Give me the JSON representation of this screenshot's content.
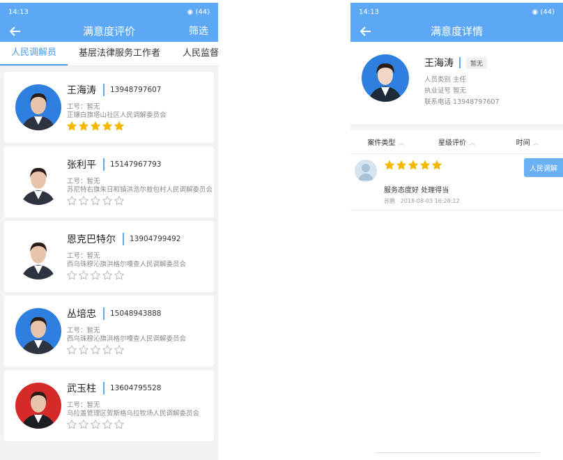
{
  "left": {
    "status": {
      "time": "14:13",
      "signal": "3G 3G",
      "battery": "44"
    },
    "appbar": {
      "title": "满意度评价",
      "action": "筛选"
    },
    "tabs": [
      "人民调解员",
      "基层法律服务工作者",
      "人民监督员"
    ],
    "people": [
      {
        "name": "王海涛",
        "phone": "13948797607",
        "job_no": "工号：暂无",
        "org": "正镶白旗塔山社区人民调解委员会",
        "rating": 5,
        "bg": "#2f7fe0"
      },
      {
        "name": "张利平",
        "phone": "15147967793",
        "job_no": "工号：暂无",
        "org": "苏尼特右旗朱日和镇洪浩尔敖包村人民调解委员会",
        "rating": 0,
        "bg": "#ffffff"
      },
      {
        "name": "恩克巴特尔",
        "phone": "13904799492",
        "job_no": "工号：暂无",
        "org": "西乌珠穆沁旗洪格尔嘎查人民调解委员会",
        "rating": 0,
        "bg": "#ffffff"
      },
      {
        "name": "丛培忠",
        "phone": "15048943888",
        "job_no": "工号：暂无",
        "org": "西乌珠穆沁旗洪格尔嘎查人民调解委员会",
        "rating": 0,
        "bg": "#2f7fe0"
      },
      {
        "name": "武玉柱",
        "phone": "13604795528",
        "job_no": "工号：暂无",
        "org": "乌拉盖管理区贺斯格乌拉牧场人民调解委员会",
        "rating": 0,
        "bg": "#d62a2a"
      }
    ]
  },
  "right": {
    "status": {
      "time": "14:13",
      "signal": "3G 3G",
      "battery": "44"
    },
    "appbar": {
      "title": "满意度详情"
    },
    "profile": {
      "name": "王海涛",
      "badge": "暂无",
      "type_line": "人员类别 主任",
      "license_line": "执业证号 暂无",
      "phone_line": "联系电话 13948797607"
    },
    "sort": [
      "案件类型",
      "星级评价",
      "时间"
    ],
    "review": {
      "rating": 5,
      "tag": "人民调解",
      "text": "服务态度好 处理得当",
      "author": "苏鹏",
      "time": "2018-08-03 16:28:12"
    }
  },
  "colors": {
    "primary": "#5ca8f5",
    "star": "#f5b800",
    "star_empty": "#b5b5b5"
  }
}
